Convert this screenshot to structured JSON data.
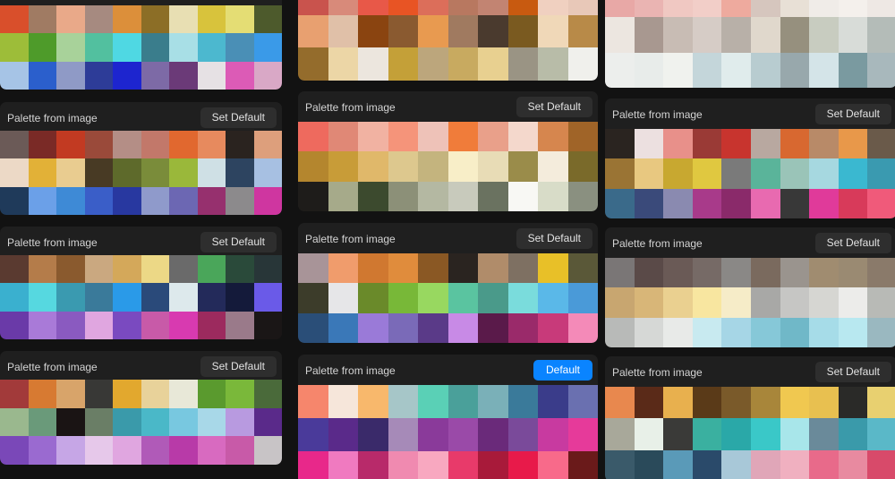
{
  "columns": [
    {
      "name": "left",
      "cards": [
        {
          "title": "",
          "button_label": "",
          "button_active": true,
          "colors": [
            "#d94f2b",
            "#a07b63",
            "#e9a989",
            "#a68a80",
            "#dc8f3a",
            "#8c6e26",
            "#e8dfb3",
            "#d8c33c",
            "#e4dd74",
            "#4d5a2c",
            "#9dbd39",
            "#4e9b2a",
            "#a8d29a",
            "#52c09f",
            "#4fd8e3",
            "#3a7d8c",
            "#a8dfe6",
            "#4cb8cf",
            "#4a8fb6",
            "#3a9ae8",
            "#a6c4e6",
            "#2b5fcc",
            "#8f9ac6",
            "#2d3c98",
            "#1d25cf",
            "#7d6aa6",
            "#6b3a78",
            "#e6e1e4",
            "#dc5bb6",
            "#d9a8c6"
          ]
        },
        {
          "title": "Palette from image",
          "button_label": "Set Default",
          "button_active": false,
          "colors": [
            "#6b5a57",
            "#7a2a26",
            "#c23a22",
            "#9a4a3a",
            "#b48e86",
            "#c2786a",
            "#e1682f",
            "#e78a5e",
            "#2a231f",
            "#dd9f7c",
            "#ecd9c6",
            "#e2b137",
            "#e9cc90",
            "#483a24",
            "#5e6a2b",
            "#7a8c3a",
            "#9ab83a",
            "#cfe0e5",
            "#2d4460",
            "#a7c0e2",
            "#1f3a5a",
            "#6ba0e8",
            "#3e8ad6",
            "#3a5ec8",
            "#2838a0",
            "#8f9acb",
            "#6c67b3",
            "#96306e",
            "#8c8a8c",
            "#cf36a0"
          ]
        },
        {
          "title": "Palette from image",
          "button_label": "Set Default",
          "button_active": false,
          "colors": [
            "#5a3a30",
            "#b47c4a",
            "#8a5a2e",
            "#caa880",
            "#d4a85a",
            "#ecd886",
            "#6a6a6a",
            "#4aa65a",
            "#2a4a3a",
            "#283638",
            "#3ab0cf",
            "#56d8e0",
            "#3a9ab0",
            "#3a7a9a",
            "#2a9ae8",
            "#2a4a7a",
            "#dde9ec",
            "#232a5a",
            "#141a3a",
            "#6a5ae8",
            "#6a3aa8",
            "#a97ad8",
            "#8a5ac0",
            "#e0a6e0",
            "#7a4ac0",
            "#c85aa8",
            "#d83ab0",
            "#9c2a5e",
            "#9a7a8a",
            "#1a1616"
          ]
        },
        {
          "title": "Palette from image",
          "button_label": "Set Default",
          "button_active": false,
          "colors": [
            "#a23a3a",
            "#d77a32",
            "#d8a46a",
            "#383836",
            "#e2a82e",
            "#e8d29a",
            "#e8e8d8",
            "#5a9a2e",
            "#7ab83a",
            "#4a6a3a",
            "#9ab88e",
            "#6a9a7a",
            "#1a1414",
            "#6a7e66",
            "#3a9aaa",
            "#4ab8c8",
            "#78c8e0",
            "#a8d8e8",
            "#b89ae0",
            "#5a2a8a",
            "#7a48b8",
            "#9a6ad0",
            "#c6a6e6",
            "#e6c8ea",
            "#e0a6e0",
            "#b05ab8",
            "#b83aa8",
            "#d86ac0",
            "#c85aa8",
            "#c8c4c6"
          ]
        }
      ]
    },
    {
      "name": "middle",
      "cards": [
        {
          "title": "",
          "button_label": "",
          "button_active": false,
          "colors": [
            "#c9534d",
            "#d88a7a",
            "#e85848",
            "#e85424",
            "#dc6e5a",
            "#b87860",
            "#c28472",
            "#c85a10",
            "#f0d0c0",
            "#e8c8b8",
            "#e8a070",
            "#e0c0a8",
            "#8a4410",
            "#8a5a30",
            "#e89a50",
            "#a07a60",
            "#4a3a2e",
            "#7a5a20",
            "#f0d8b8",
            "#b88a48",
            "#946c2c",
            "#ecd6a6",
            "#ece6de",
            "#c4a038",
            "#bca67c",
            "#c8aa60",
            "#e8d090",
            "#9a9484",
            "#b8bca8",
            "#f0f0ec"
          ]
        },
        {
          "title": "Palette from image",
          "button_label": "Set Default",
          "button_active": false,
          "colors": [
            "#ee6a5e",
            "#e08876",
            "#f1b2a2",
            "#f5947a",
            "#eec2b8",
            "#f07c3a",
            "#e9a08a",
            "#f4d8cc",
            "#d6864e",
            "#a06428",
            "#b4862e",
            "#c89c38",
            "#e0b86a",
            "#ddc88e",
            "#c4b47e",
            "#f8eec8",
            "#e8dcb6",
            "#9a8c4a",
            "#f4ecdc",
            "#7a6a2a",
            "#1e1c1a",
            "#a6aa8a",
            "#3c4a2e",
            "#8c9078",
            "#b4b8a2",
            "#c8cabc",
            "#6a7260",
            "#f8f8f4",
            "#d8dcc8",
            "#8a9080"
          ]
        },
        {
          "title": "Palette from image",
          "button_label": "Set Default",
          "button_active": false,
          "colors": [
            "#a89498",
            "#f09c6c",
            "#d07830",
            "#e08c3c",
            "#8a5824",
            "#2a2420",
            "#b08c6a",
            "#7e7062",
            "#e8c028",
            "#5a5838",
            "#3c3c2a",
            "#e6e6e8",
            "#6a8a2a",
            "#78b838",
            "#98d860",
            "#5ac4a0",
            "#4a9a8a",
            "#7adcdc",
            "#5ab8e8",
            "#4a9ad8",
            "#2a4e78",
            "#3a78b8",
            "#9a7ad8",
            "#7a6ab8",
            "#5a3a88",
            "#c88ae6",
            "#5a1a4a",
            "#9a2a6a",
            "#c83a7a",
            "#f48ab8"
          ]
        },
        {
          "title": "Palette from image",
          "button_label": "Default",
          "button_active": true,
          "colors": [
            "#f6866c",
            "#f6e6da",
            "#f8b86c",
            "#a6c6c8",
            "#5ad0b6",
            "#4aa09a",
            "#7ab0b8",
            "#3a7a9a",
            "#3a3c8a",
            "#6a70b0",
            "#4a3a9a",
            "#5a2a8a",
            "#3a2a6a",
            "#a68ab8",
            "#8a3a9a",
            "#9a4aa8",
            "#6a2a7a",
            "#7a4a9a",
            "#c83aa0",
            "#e63a9a",
            "#e8288a",
            "#f07ac0",
            "#b82a6a",
            "#f08ab0",
            "#f8a8c0",
            "#e83a6a",
            "#a81a3a",
            "#e81a4a",
            "#f86a8a",
            "#6a1a1a"
          ]
        }
      ]
    },
    {
      "name": "right",
      "cards": [
        {
          "title": "",
          "button_label": "",
          "button_active": false,
          "colors": [
            "#e8a8a6",
            "#eab4b2",
            "#f0c8c2",
            "#f2cec8",
            "#eeaa9e",
            "#d6c6be",
            "#e8e0d6",
            "#f0ece8",
            "#f4f0ec",
            "#eee8e4",
            "#ece6e0",
            "#a89890",
            "#c8bcb4",
            "#d6ccc6",
            "#b8b0a8",
            "#e0d8cc",
            "#96907e",
            "#c8ccc0",
            "#d8dcd8",
            "#b4bcb8",
            "#eceeec",
            "#e8ecea",
            "#f0f2ee",
            "#c4d6da",
            "#e0ecec",
            "#b8ccd0",
            "#98a8ac",
            "#d4e4e8",
            "#7a9aa0",
            "#a8b8bc"
          ]
        },
        {
          "title": "Palette from image",
          "button_label": "Set Default",
          "button_active": false,
          "colors": [
            "#2a2420",
            "#ece0e0",
            "#e8908a",
            "#9a3a36",
            "#c8342e",
            "#b8a8a0",
            "#d86830",
            "#b88a68",
            "#e8984a",
            "#6a5a4a",
            "#9a7434",
            "#e8c880",
            "#c8a830",
            "#e0c840",
            "#7a7a7a",
            "#5ab49a",
            "#9ac4b8",
            "#a6d8e0",
            "#3ab8d0",
            "#3a9ab0",
            "#3a6a8a",
            "#3a4a7a",
            "#8a8ab0",
            "#a83a8a",
            "#8a2a6a",
            "#e86ab0",
            "#383838",
            "#e03a9a",
            "#d83a5a",
            "#f05a7a"
          ]
        },
        {
          "title": "Palette from image",
          "button_label": "Set Default",
          "button_active": false,
          "colors": [
            "#7a7676",
            "#5a4a48",
            "#6a5a56",
            "#766a66",
            "#8a8886",
            "#7a6a5e",
            "#9a948e",
            "#a08c70",
            "#9a8a72",
            "#8a7a6a",
            "#c8a670",
            "#d8b678",
            "#ead090",
            "#f8e6a0",
            "#f6ecc8",
            "#a8a8a6",
            "#c6c6c4",
            "#d6d6d2",
            "#ececea",
            "#b8bab6",
            "#b8bab8",
            "#d6d8d6",
            "#e8eae8",
            "#c8eaf0",
            "#a6d6e6",
            "#86c8d8",
            "#70b8c8",
            "#a6dce8",
            "#b8e8f0",
            "#9ab8c0"
          ]
        },
        {
          "title": "Palette from image",
          "button_label": "Set Default",
          "button_active": false,
          "colors": [
            "#e8884e",
            "#5a2a18",
            "#e8b04e",
            "#5a3a18",
            "#7a5a2a",
            "#a8863a",
            "#f0c850",
            "#e8c050",
            "#2a2a28",
            "#e8d070",
            "#a8a89a",
            "#e8f0e8",
            "#3a3a38",
            "#3ab0a0",
            "#2aa8a8",
            "#3ac8c8",
            "#a8e6ea",
            "#6a8a9a",
            "#3a9aaa",
            "#5ab8c8",
            "#3a5a6a",
            "#2a4a5a",
            "#5a9ab8",
            "#2a4a6a",
            "#a8c8d8",
            "#e0a6b8",
            "#f0b0c0",
            "#e86a8a",
            "#e88aa0",
            "#d84a6a"
          ]
        }
      ]
    }
  ]
}
